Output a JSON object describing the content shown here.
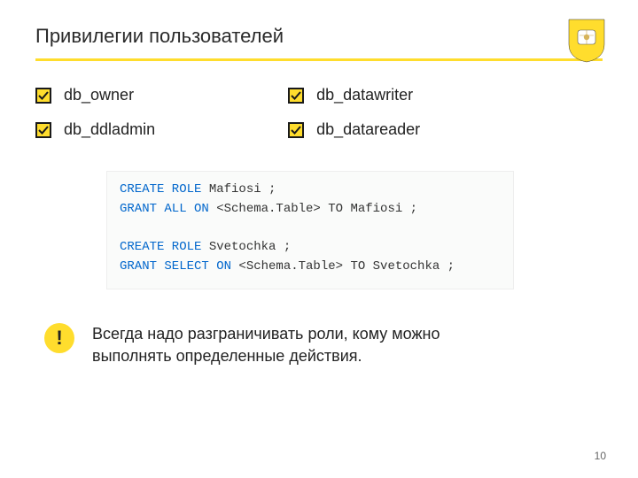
{
  "title": "Привилегии пользователей",
  "roles": {
    "left": [
      "db_owner",
      "db_ddladmin"
    ],
    "right": [
      "db_datawriter",
      "db_datareader"
    ]
  },
  "code": {
    "lines": [
      {
        "kw": "CREATE ROLE ",
        "rest": "Mafiosi ;"
      },
      {
        "kw": "GRANT ALL ON ",
        "rest": "<Schema.Table> TO Mafiosi ;"
      },
      {
        "kw": "",
        "rest": ""
      },
      {
        "kw": "CREATE ROLE ",
        "rest": "Svetochka ;"
      },
      {
        "kw": "GRANT SELECT ON ",
        "rest": "<Schema.Table> TO Svetochka ;"
      }
    ]
  },
  "note": {
    "icon": "!",
    "text": "Всегда надо разграничивать роли, кому можно выполнять определенные действия."
  },
  "page_number": "10"
}
